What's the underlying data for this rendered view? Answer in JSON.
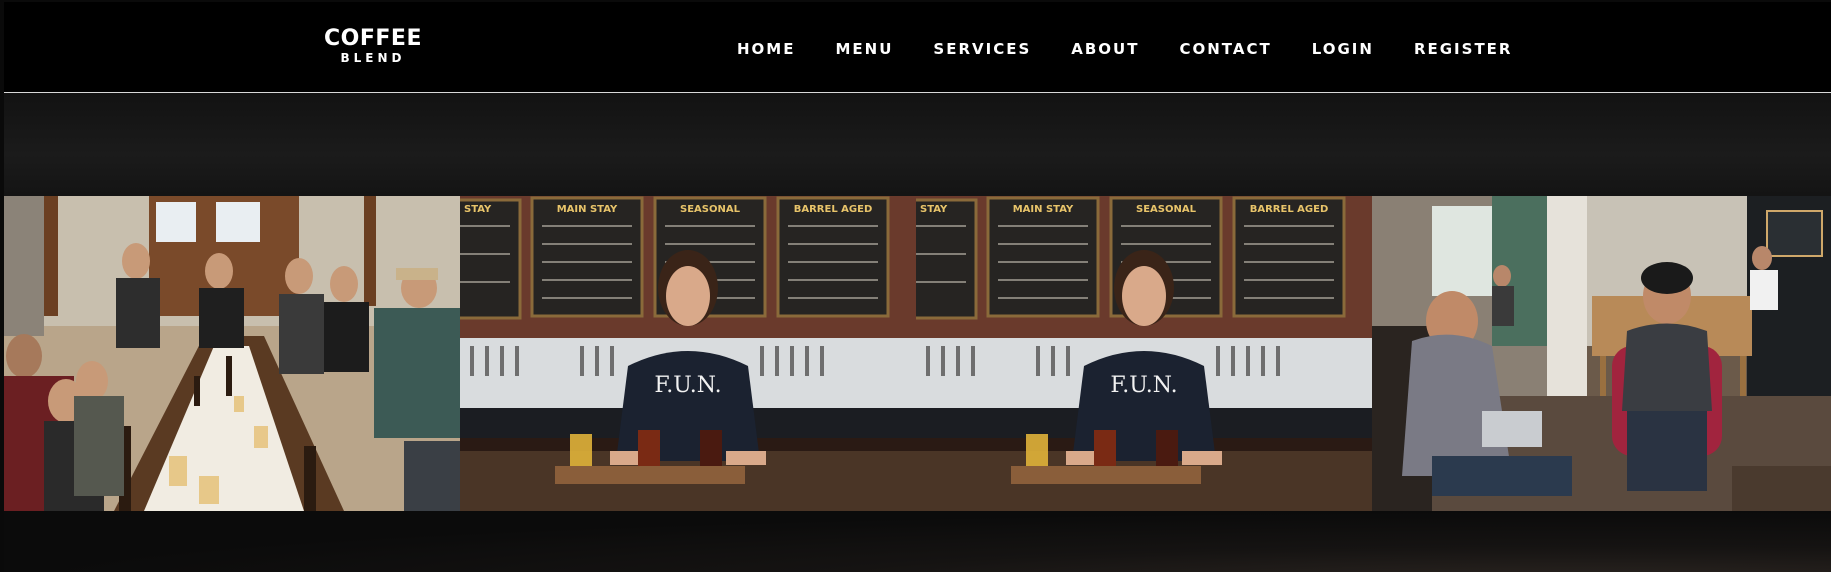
{
  "brand": {
    "name_main": "COFFEE",
    "name_sub": "BLEND"
  },
  "nav": {
    "items": [
      {
        "label": "HOME"
      },
      {
        "label": "MENU"
      },
      {
        "label": "SERVICES"
      },
      {
        "label": "ABOUT"
      },
      {
        "label": "CONTACT"
      },
      {
        "label": "LOGIN"
      },
      {
        "label": "REGISTER"
      }
    ]
  },
  "gallery": {
    "photos": [
      {
        "subject": "group-tasting-table"
      },
      {
        "subject": "bartender-flight"
      },
      {
        "subject": "bartender-flight"
      },
      {
        "subject": "cafe-laptop-chat"
      }
    ],
    "signage": [
      "MAIN STAY",
      "SEASONAL",
      "BARREL AGED",
      "STAY"
    ],
    "shirt_text": "F.U.N."
  }
}
